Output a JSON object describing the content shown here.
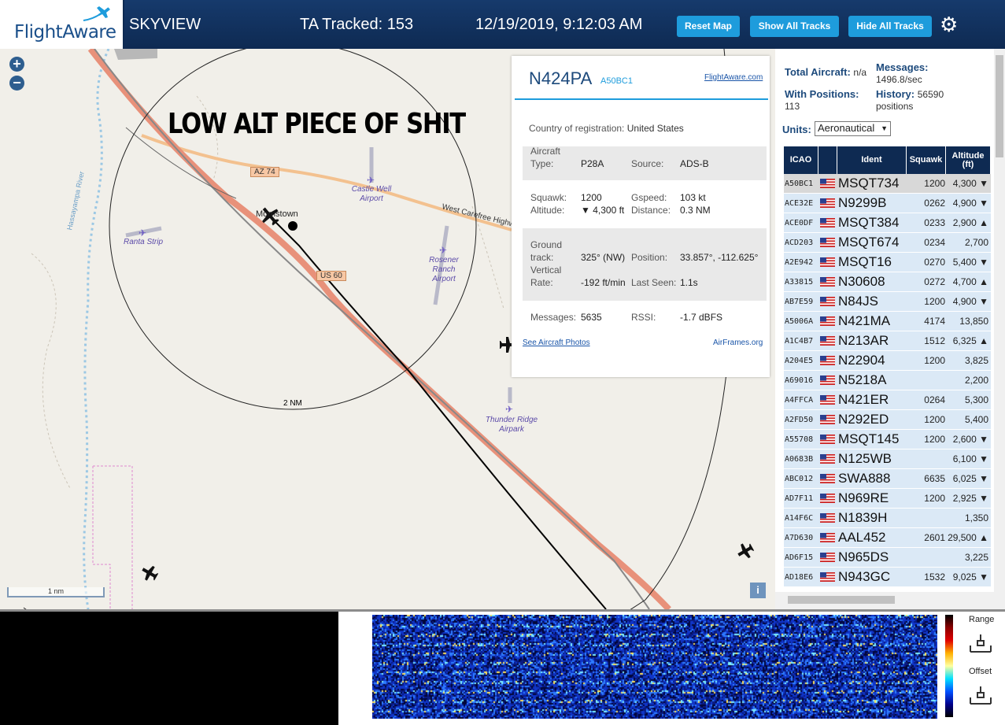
{
  "header": {
    "logo_text": "FlightAware",
    "app_name": "SKYVIEW",
    "ta_tracked": "TA Tracked: 153",
    "datetime": "12/19/2019, 9:12:03 AM",
    "buttons": {
      "reset": "Reset Map",
      "show_all": "Show All Tracks",
      "hide_all": "Hide All Tracks"
    },
    "settings_icon": "gear-icon"
  },
  "map": {
    "zoom_in": "+",
    "zoom_out": "−",
    "annotation": "LOW ALT PIECE OF SHIT",
    "airports": [
      "Castle Well Airport",
      "Ranta Strip",
      "Rosener Ranch Airport",
      "Thunder Ridge Airpark"
    ],
    "roads": [
      "AZ 74",
      "West Carefree Highway",
      "US 60"
    ],
    "river": "Hassayampa River",
    "town": "Morristown",
    "range_label": "2 NM",
    "scale_label": "1 nm",
    "info": "i"
  },
  "popup": {
    "ident": "N424PA",
    "icao": "A50BC1",
    "flightaware_link": "FlightAware.com",
    "country_label": "Country of registration:",
    "country": "United States",
    "aircraft_type_label": "Aircraft Type:",
    "aircraft_type": "P28A",
    "source_label": "Source:",
    "source": "ADS-B",
    "squawk_label": "Squawk:",
    "squawk": "1200",
    "gspeed_label": "Gspeed:",
    "gspeed": "103 kt",
    "altitude_label": "Altitude:",
    "altitude": "▼ 4,300 ft",
    "distance_label": "Distance:",
    "distance": "0.3 NM",
    "ground_track_label": "Ground track:",
    "ground_track": "325° (NW)",
    "position_label": "Position:",
    "position": "33.857°, -112.625°",
    "vrate_label": "Vertical Rate:",
    "vrate": "-192 ft/min",
    "last_seen_label": "Last Seen:",
    "last_seen": "1.1s",
    "messages_label": "Messages:",
    "messages": "5635",
    "rssi_label": "RSSI:",
    "rssi": "-1.7 dBFS",
    "photos_link": "See Aircraft Photos",
    "airframes_link": "AirFrames.org"
  },
  "stats": {
    "total_label": "Total Aircraft:",
    "total_value": "n/a",
    "messages_label": "Messages:",
    "messages_value": "1496.8/sec",
    "positions_label": "With Positions:",
    "positions_value": "113",
    "history_label": "History:",
    "history_value": "56590 positions",
    "units_label": "Units:",
    "units_value": "Aeronautical"
  },
  "table": {
    "headers": [
      "ICAO",
      "",
      "Ident",
      "Squawk",
      "Altitude (ft)"
    ],
    "rows": [
      {
        "icao": "A50BC1",
        "ident": "MSQT734",
        "squawk": "1200",
        "alt": "4,300 ▼"
      },
      {
        "icao": "ACE32E",
        "ident": "N9299B",
        "squawk": "0262",
        "alt": "4,900 ▼"
      },
      {
        "icao": "ACE0DF",
        "ident": "MSQT384",
        "squawk": "0233",
        "alt": "2,900 ▲"
      },
      {
        "icao": "ACD203",
        "ident": "MSQT674",
        "squawk": "0234",
        "alt": "2,700"
      },
      {
        "icao": "A2E942",
        "ident": "MSQT16",
        "squawk": "0270",
        "alt": "5,400 ▼"
      },
      {
        "icao": "A33815",
        "ident": "N30608",
        "squawk": "0272",
        "alt": "4,700 ▲"
      },
      {
        "icao": "AB7E59",
        "ident": "N84JS",
        "squawk": "1200",
        "alt": "4,900 ▼"
      },
      {
        "icao": "A5006A",
        "ident": "N421MA",
        "squawk": "4174",
        "alt": "13,850"
      },
      {
        "icao": "A1C4B7",
        "ident": "N213AR",
        "squawk": "1512",
        "alt": "6,325 ▲"
      },
      {
        "icao": "A204E5",
        "ident": "N22904",
        "squawk": "1200",
        "alt": "3,825"
      },
      {
        "icao": "A69016",
        "ident": "N5218A",
        "squawk": "",
        "alt": "2,200"
      },
      {
        "icao": "A4FFCA",
        "ident": "N421ER",
        "squawk": "0264",
        "alt": "5,300"
      },
      {
        "icao": "A2FD50",
        "ident": "N292ED",
        "squawk": "1200",
        "alt": "5,400"
      },
      {
        "icao": "A55708",
        "ident": "MSQT145",
        "squawk": "1200",
        "alt": "2,600 ▼"
      },
      {
        "icao": "A0683B",
        "ident": "N125WB",
        "squawk": "",
        "alt": "6,100 ▼"
      },
      {
        "icao": "ABC012",
        "ident": "SWA888",
        "squawk": "6635",
        "alt": "6,025 ▼"
      },
      {
        "icao": "AD7F11",
        "ident": "N969RE",
        "squawk": "1200",
        "alt": "2,925 ▼"
      },
      {
        "icao": "A14F6C",
        "ident": "N1839H",
        "squawk": "",
        "alt": "1,350"
      },
      {
        "icao": "A7D630",
        "ident": "AAL452",
        "squawk": "2601",
        "alt": "29,500 ▲"
      },
      {
        "icao": "AD6F15",
        "ident": "N965DS",
        "squawk": "",
        "alt": "3,225"
      },
      {
        "icao": "AD18E6",
        "ident": "N943GC",
        "squawk": "1532",
        "alt": "9,025 ▼"
      }
    ]
  },
  "spectrum": {
    "range_label": "Range",
    "offset_label": "Offset"
  }
}
